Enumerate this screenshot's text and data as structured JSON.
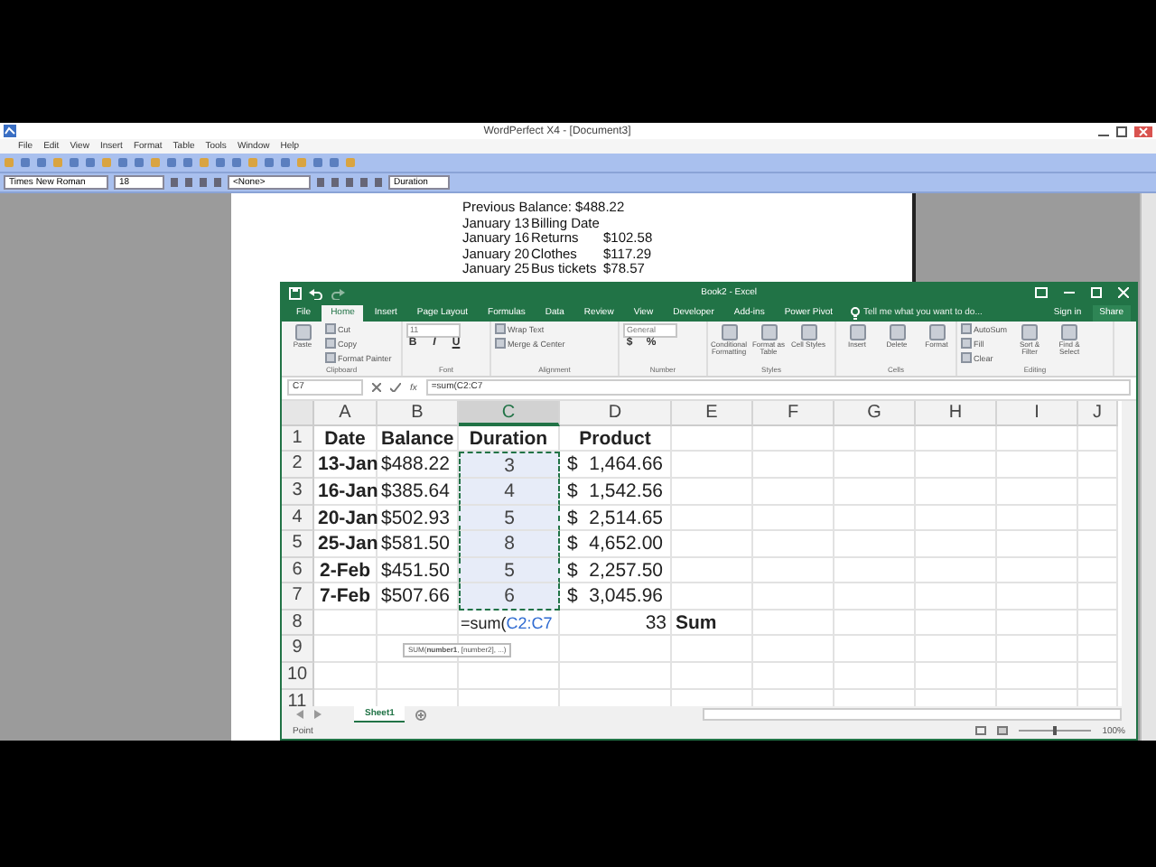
{
  "wordperfect": {
    "title": "WordPerfect X4 - [Document3]",
    "menu": [
      "File",
      "Edit",
      "View",
      "Insert",
      "Format",
      "Table",
      "Tools",
      "Window",
      "Help"
    ],
    "font_name": "Times New Roman",
    "font_size": "18",
    "style": "<None>",
    "table_style": "Duration",
    "document_lines": [
      {
        "kind": "text",
        "text": "Previous Balance: $488.22"
      },
      {
        "kind": "entry",
        "date": "January 13",
        "description": "Billing Date"
      },
      {
        "kind": "entry",
        "date": "January 16",
        "description": "Returns",
        "amount": "$102.58"
      },
      {
        "kind": "entry",
        "date": "January 20",
        "description": "Clothes",
        "amount": "$117.29"
      },
      {
        "kind": "entry",
        "date": "January 25",
        "description": "Bus tickets",
        "amount": "$78.57"
      }
    ]
  },
  "excel": {
    "title": "Book2 - Excel",
    "tabs": [
      {
        "label": "File",
        "selected": false
      },
      {
        "label": "Home",
        "selected": true
      },
      {
        "label": "Insert",
        "selected": false
      },
      {
        "label": "Page Layout",
        "selected": false
      },
      {
        "label": "Formulas",
        "selected": false
      },
      {
        "label": "Data",
        "selected": false
      },
      {
        "label": "Review",
        "selected": false
      },
      {
        "label": "View",
        "selected": false
      },
      {
        "label": "Developer",
        "selected": false
      },
      {
        "label": "Add-ins",
        "selected": false
      },
      {
        "label": "Power Pivot",
        "selected": false
      }
    ],
    "tell_me": "Tell me what you want to do...",
    "sign_in": "Sign in",
    "share": "Share",
    "ribbon_groups": [
      {
        "label": "Clipboard",
        "items": [
          {
            "kind": "large",
            "text": "Paste"
          },
          {
            "kind": "small",
            "text": "Cut"
          },
          {
            "kind": "small",
            "text": "Copy"
          },
          {
            "kind": "small",
            "text": "Format Painter"
          }
        ]
      },
      {
        "label": "Font",
        "items": [
          {
            "kind": "field",
            "text": "11"
          },
          {
            "kind": "bold",
            "text": "B"
          },
          {
            "kind": "italic",
            "text": "I"
          },
          {
            "kind": "underline",
            "text": "U"
          }
        ]
      },
      {
        "label": "Alignment",
        "items": [
          {
            "kind": "small",
            "text": "Wrap Text"
          },
          {
            "kind": "small",
            "text": "Merge & Center"
          }
        ]
      },
      {
        "label": "Number",
        "items": [
          {
            "kind": "field",
            "text": "General"
          },
          {
            "kind": "currency",
            "text": "$"
          },
          {
            "kind": "percent",
            "text": "%"
          }
        ]
      },
      {
        "label": "Styles",
        "items": [
          {
            "kind": "large",
            "text": "Conditional Formatting"
          },
          {
            "kind": "large",
            "text": "Format as Table"
          },
          {
            "kind": "large",
            "text": "Cell Styles"
          }
        ]
      },
      {
        "label": "Cells",
        "items": [
          {
            "kind": "large",
            "text": "Insert"
          },
          {
            "kind": "large",
            "text": "Delete"
          },
          {
            "kind": "large",
            "text": "Format"
          }
        ]
      },
      {
        "label": "Editing",
        "items": [
          {
            "kind": "small",
            "text": "AutoSum"
          },
          {
            "kind": "small",
            "text": "Fill"
          },
          {
            "kind": "small",
            "text": "Clear"
          },
          {
            "kind": "large",
            "text": "Sort & Filter"
          },
          {
            "kind": "large",
            "text": "Find & Select"
          }
        ]
      }
    ],
    "name_box": "C7",
    "function_label": "fx",
    "formula": "=sum(C2:C7",
    "columns": [
      "A",
      "B",
      "C",
      "D",
      "E",
      "F",
      "G",
      "H",
      "I",
      "J"
    ],
    "rows": [
      {
        "header": "1",
        "cells": [
          {
            "kind": "plain",
            "text": "Date",
            "bold": true,
            "selected": false
          },
          {
            "kind": "plain",
            "text": "Balance",
            "bold": true,
            "selected": false
          },
          {
            "kind": "plain",
            "text": "Duration",
            "bold": true,
            "selected": false
          },
          {
            "kind": "plain",
            "text": "Product",
            "bold": true,
            "selected": false
          }
        ]
      },
      {
        "header": "2",
        "cells": [
          {
            "kind": "plain",
            "text": "13-Jan",
            "bold": true,
            "selected": false
          },
          {
            "kind": "plain",
            "text": "$488.22",
            "bold": false,
            "selected": false
          },
          {
            "kind": "plain",
            "text": "3",
            "bold": false,
            "selected": true
          },
          {
            "kind": "accounting",
            "symbol": "$",
            "text": "1,464.66",
            "bold": false,
            "selected": false
          }
        ]
      },
      {
        "header": "3",
        "cells": [
          {
            "kind": "plain",
            "text": "16-Jan",
            "bold": true,
            "selected": false
          },
          {
            "kind": "plain",
            "text": "$385.64",
            "bold": false,
            "selected": false
          },
          {
            "kind": "plain",
            "text": "4",
            "bold": false,
            "selected": true
          },
          {
            "kind": "accounting",
            "symbol": "$",
            "text": "1,542.56",
            "bold": false,
            "selected": false
          }
        ]
      },
      {
        "header": "4",
        "cells": [
          {
            "kind": "plain",
            "text": "20-Jan",
            "bold": true,
            "selected": false
          },
          {
            "kind": "plain",
            "text": "$502.93",
            "bold": false,
            "selected": false
          },
          {
            "kind": "plain",
            "text": "5",
            "bold": false,
            "selected": true
          },
          {
            "kind": "accounting",
            "symbol": "$",
            "text": "2,514.65",
            "bold": false,
            "selected": false
          }
        ]
      },
      {
        "header": "5",
        "cells": [
          {
            "kind": "plain",
            "text": "25-Jan",
            "bold": true,
            "selected": false
          },
          {
            "kind": "plain",
            "text": "$581.50",
            "bold": false,
            "selected": false
          },
          {
            "kind": "plain",
            "text": "8",
            "bold": false,
            "selected": true
          },
          {
            "kind": "accounting",
            "symbol": "$",
            "text": "4,652.00",
            "bold": false,
            "selected": false
          }
        ]
      },
      {
        "header": "6",
        "cells": [
          {
            "kind": "plain",
            "text": "2-Feb",
            "bold": true,
            "selected": false
          },
          {
            "kind": "plain",
            "text": "$451.50",
            "bold": false,
            "selected": false
          },
          {
            "kind": "plain",
            "text": "5",
            "bold": false,
            "selected": true
          },
          {
            "kind": "accounting",
            "symbol": "$",
            "text": "2,257.50",
            "bold": false,
            "selected": false
          }
        ]
      },
      {
        "header": "7",
        "cells": [
          {
            "kind": "plain",
            "text": "7-Feb",
            "bold": true,
            "selected": false
          },
          {
            "kind": "plain",
            "text": "$507.66",
            "bold": false,
            "selected": false
          },
          {
            "kind": "plain",
            "text": "6",
            "bold": false,
            "selected": true
          },
          {
            "kind": "accounting",
            "symbol": "$",
            "text": "3,045.96",
            "bold": false,
            "selected": false
          }
        ]
      },
      {
        "header": "8",
        "cells": [
          "",
          "",
          {
            "kind": "formula",
            "text": "=sum(",
            "ref": "C2:C7",
            "bold": false,
            "selected": false
          },
          {
            "kind": "number",
            "text": "33",
            "bold": false,
            "selected": false
          },
          {
            "kind": "plain",
            "text": "Sum",
            "bold": true,
            "selected": false
          }
        ]
      },
      {
        "header": "9",
        "cells": []
      },
      {
        "header": "10",
        "cells": []
      },
      {
        "header": "11",
        "cells": []
      }
    ],
    "tooltip": "SUM(**number1**, [number2], ...)",
    "sheet_tabs": [
      {
        "label": "Sheet1",
        "selected": true
      }
    ],
    "status": "Point",
    "zoom_slider": {
      "level": 0.5
    },
    "zoom": "100%"
  }
}
